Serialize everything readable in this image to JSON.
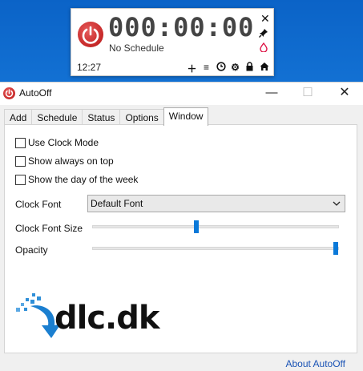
{
  "widget": {
    "timer": "000:00:00",
    "schedule": "No Schedule",
    "time": "12:27",
    "icons": [
      "power-icon",
      "close-icon",
      "pin-icon",
      "drop-icon",
      "plus-icon",
      "menu-icon",
      "clock-icon",
      "gear-icon",
      "lock-icon",
      "home-icon"
    ]
  },
  "window": {
    "title": "AutoOff",
    "controls": {
      "minimize": "—",
      "maximize": "☐",
      "close": "✕"
    }
  },
  "tabs": [
    {
      "label": "Add",
      "active": false
    },
    {
      "label": "Schedule",
      "active": false
    },
    {
      "label": "Status",
      "active": false
    },
    {
      "label": "Options",
      "active": false
    },
    {
      "label": "Window",
      "active": true
    }
  ],
  "window_tab": {
    "checkboxes": [
      {
        "label": "Use Clock Mode",
        "checked": false
      },
      {
        "label": "Show always on top",
        "checked": false
      },
      {
        "label": "Show the day of the week",
        "checked": false
      }
    ],
    "clock_font_label": "Clock Font",
    "clock_font_value": "Default Font",
    "clock_font_size_label": "Clock Font Size",
    "clock_font_size_level": 0.42,
    "opacity_label": "Opacity",
    "opacity_level": 1.0
  },
  "watermark": "dlc.dk",
  "footer": {
    "about_link": "About AutoOff"
  },
  "colors": {
    "accent": "#0a79d9",
    "power": "#c62828",
    "link": "#1a53b5"
  }
}
